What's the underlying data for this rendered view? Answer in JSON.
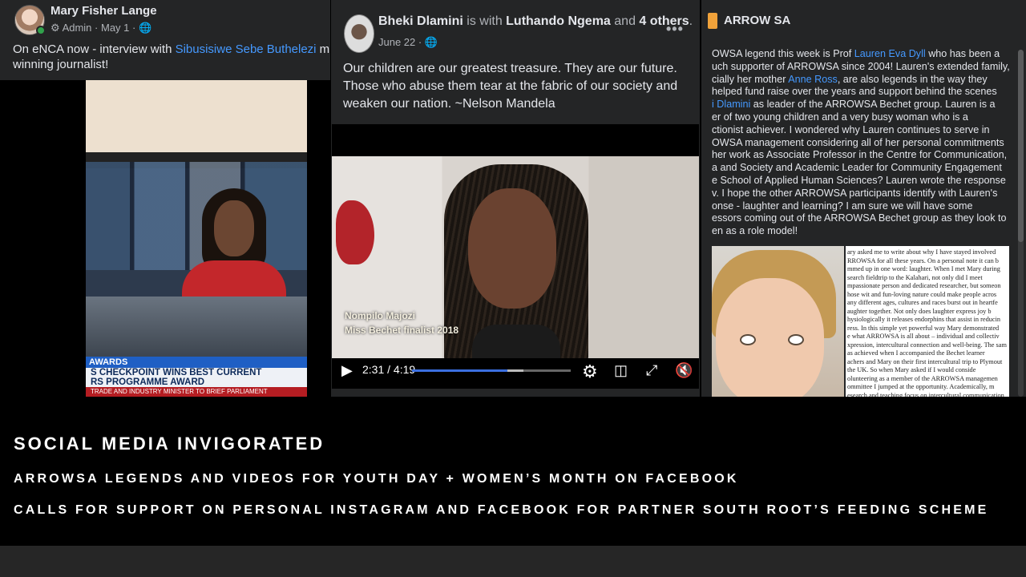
{
  "post1": {
    "author": "Mary Fisher Lange",
    "role": "Admin",
    "date": "May 1",
    "text_before": "On eNCA now - interview with ",
    "text_link": "Sibusisiwe Sebe Buthelezi",
    "text_after": " multi-award",
    "text_line2": "winning journalist!",
    "tv_ticker_top": "AWARDS",
    "tv_ticker_main_1": "S CHECKPOINT WINS BEST CURRENT",
    "tv_ticker_main_2": "RS PROGRAMME AWARD",
    "tv_ticker_bottom": "TRADE AND INDUSTRY MINISTER TO BRIEF PARLIAMENT"
  },
  "post2": {
    "author": "Bheki Dlamini",
    "with_text": " is with ",
    "tagged": "Luthando Ngema",
    "and_text": " and ",
    "others": "4 others",
    "date": "June 22",
    "more_icon": "•••",
    "quote": "Our children are our greatest treasure. They are our future. Those who abuse them tear at the fabric of our society and weaken our nation. ~Nelson Mandela",
    "video": {
      "caption_name": "Nompilo Majozi",
      "caption_title": "Miss Bechet finalist 2018",
      "time": "2:31 / 4:19",
      "progress": 0.6,
      "buffered": 0.7
    }
  },
  "post3": {
    "page_name": "ARROW SA",
    "lines": [
      [
        "OWSA legend this week is Prof ",
        "Lauren Eva Dyll",
        " who has been a"
      ],
      [
        "uch supporter of ARROWSA since 2004! Lauren's extended family,",
        "",
        ""
      ],
      [
        "cially her mother ",
        "Anne Ross",
        ", are also legends in the way they"
      ],
      [
        "helped fund raise over the years and support behind the scenes",
        "",
        ""
      ],
      [
        "",
        "i Dlamini",
        " as leader of the ARROWSA Bechet group. Lauren is a"
      ],
      [
        "er of two young children and a very busy woman who is a",
        "",
        ""
      ],
      [
        "ctionist achiever. I wondered why Lauren continues to serve in",
        "",
        ""
      ],
      [
        "OWSA management considering all of her personal commitments",
        "",
        ""
      ],
      [
        "her work as Associate Professor in the Centre for Communication,",
        "",
        ""
      ],
      [
        "a and Society and Academic Leader for Community Engagement",
        "",
        ""
      ],
      [
        "e School of Applied Human Sciences? Lauren wrote the response",
        "",
        ""
      ],
      [
        "v. I hope the other ARROWSA participants identify with Lauren's",
        "",
        ""
      ],
      [
        "onse - laughter and learning? I am sure we will have some",
        "",
        ""
      ],
      [
        "essors coming out of the ARROWSA Bechet group as they look to",
        "",
        ""
      ],
      [
        "en as a role model!",
        "",
        ""
      ]
    ],
    "doc_lines": [
      "ary asked me to write about why I have stayed involved",
      "RROWSA for all these years. On a personal note it can b",
      "mmed up in one word: laughter. When I met Mary during",
      "search fieldtrip to the Kalahari, not only did I meet",
      "mpassionate person and dedicated researcher, but someon",
      "hose wit and fun-loving nature could make people acros",
      "any different ages, cultures and races burst out in heartfe",
      "aughter together. Not only does laughter express joy b",
      "hysiologically it releases endorphins that assist in reducin",
      "ress. In this simple yet powerful way Mary demonstrated",
      "e what ARROWSA is all about – individual and collectiv",
      "xpression, intercultural connection and well-being. The sam",
      "as achieved when I accompanied the Bechet learner",
      "achers and Mary on their first intercultural trip to Plymout",
      "the UK. So when Mary asked if I would conside",
      "olunteering as a member of the ARROWSA managemen",
      "ommittee I jumped at the opportunity. Academically, m",
      "esearch and teaching focus on intercultural communication"
    ]
  },
  "banner": {
    "heading": "SOCIAL MEDIA INVIGORATED",
    "line1": "ARROWSA LEGENDS AND VIDEOS FOR YOUTH DAY + WOMEN’S MONTH ON FACEBOOK",
    "line2": "CALLS FOR SUPPORT ON PERSONAL INSTAGRAM AND FACEBOOK FOR PARTNER SOUTH ROOT’S FEEDING SCHEME"
  },
  "colors": {
    "link": "#4599ff",
    "panel_bg": "#242526",
    "progress": "#3b6fe0"
  }
}
